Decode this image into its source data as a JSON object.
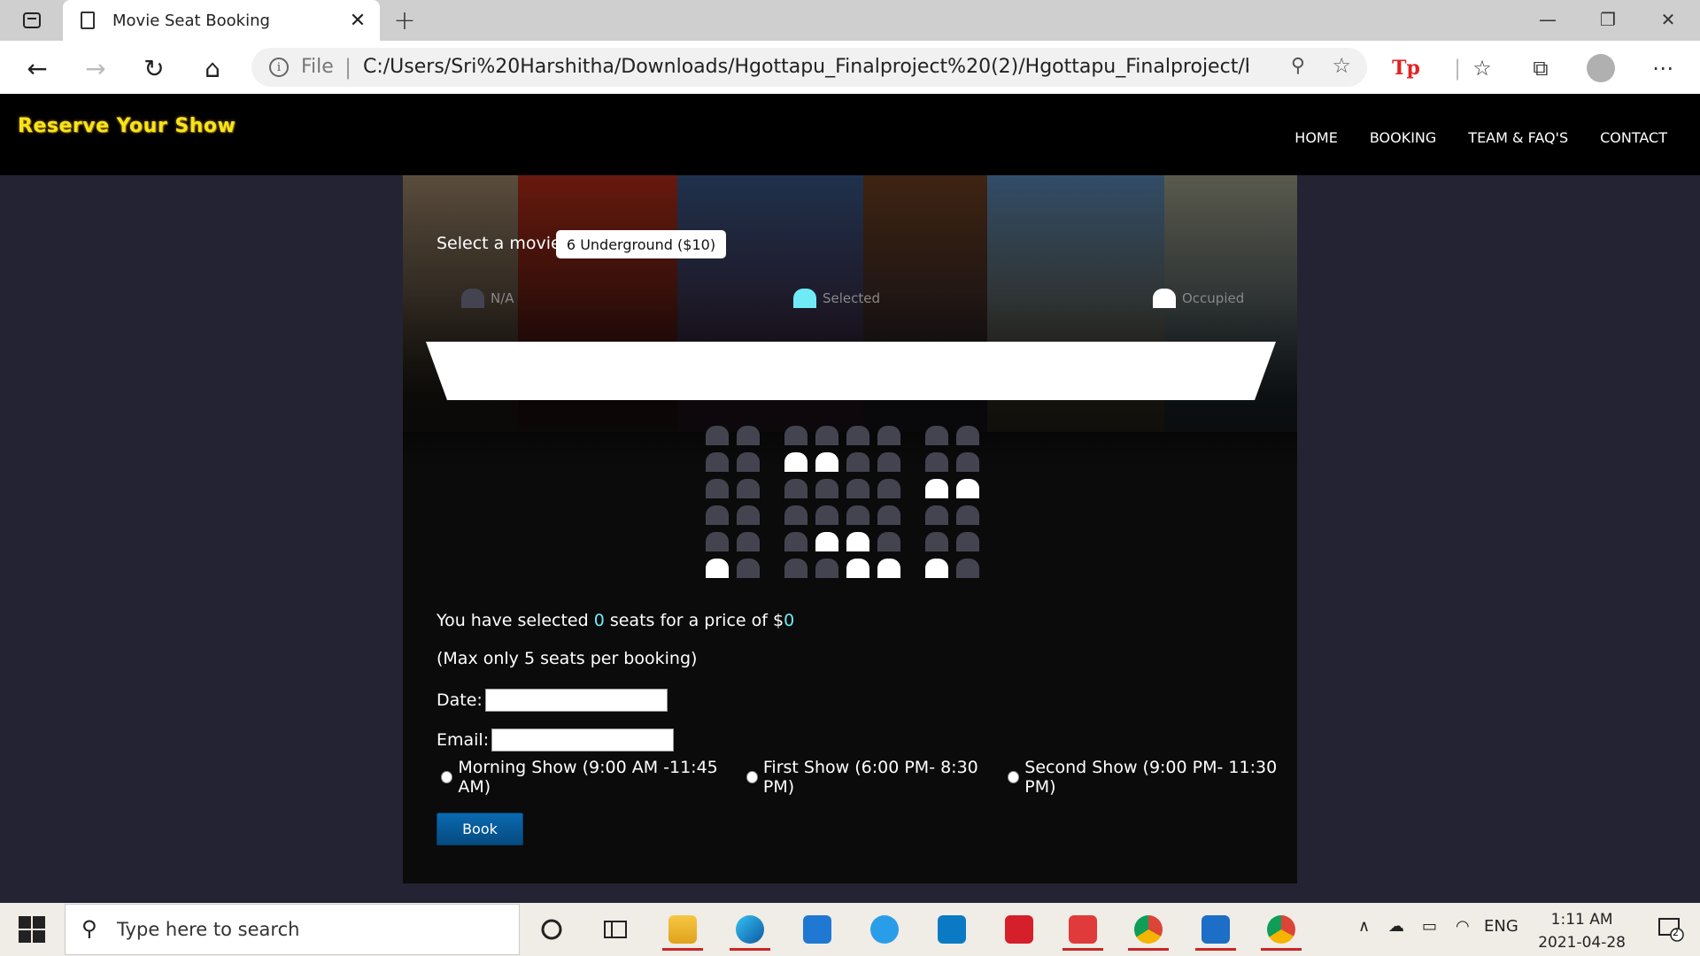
{
  "browser": {
    "tab_title": "Movie Seat Booking",
    "address_prefix": "File",
    "url": "C:/Users/Sri%20Harshitha/Downloads/Hgottapu_Finalproject%20(2)/Hgottapu_Finalproject/bo..."
  },
  "site": {
    "brand": "Reserve Your Show",
    "nav": [
      "HOME",
      "BOOKING",
      "TEAM & FAQ'S",
      "CONTACT"
    ]
  },
  "booking": {
    "movie_label": "Select a movie",
    "movie_selected": "6 Underground ($10)",
    "legend": {
      "na": "N/A",
      "selected": "Selected",
      "occupied": "Occupied"
    },
    "legend_colors": {
      "na": "#444451",
      "selected": "#6feaf6",
      "occupied": "#ffffff"
    },
    "summary_prefix": "You have selected ",
    "selected_count": "0",
    "summary_middle": " seats for a price of $",
    "total_price": "0",
    "max_note": "(Max only 5 seats per booking)",
    "date_label": "Date:",
    "email_label": "Email:",
    "show_options": [
      "Morning Show (9:00 AM -11:45 AM)",
      "First Show (6:00 PM- 8:30 PM)",
      "Second Show (9:00 PM- 11:30 PM)"
    ],
    "book_button": "Book",
    "seat_rows": [
      [
        "na",
        "na",
        "na",
        "na",
        "na",
        "na",
        "na",
        "na"
      ],
      [
        "na",
        "na",
        "occupied",
        "occupied",
        "na",
        "na",
        "na",
        "na"
      ],
      [
        "na",
        "na",
        "na",
        "na",
        "na",
        "na",
        "occupied",
        "occupied"
      ],
      [
        "na",
        "na",
        "na",
        "na",
        "na",
        "na",
        "na",
        "na"
      ],
      [
        "na",
        "na",
        "na",
        "occupied",
        "occupied",
        "na",
        "na",
        "na"
      ],
      [
        "occupied",
        "na",
        "na",
        "na",
        "occupied",
        "occupied",
        "occupied",
        "na"
      ]
    ]
  },
  "taskbar": {
    "search_placeholder": "Type here to search",
    "language": "ENG",
    "time": "1:11 AM",
    "date": "2021-04-28",
    "notification_count": "2"
  }
}
